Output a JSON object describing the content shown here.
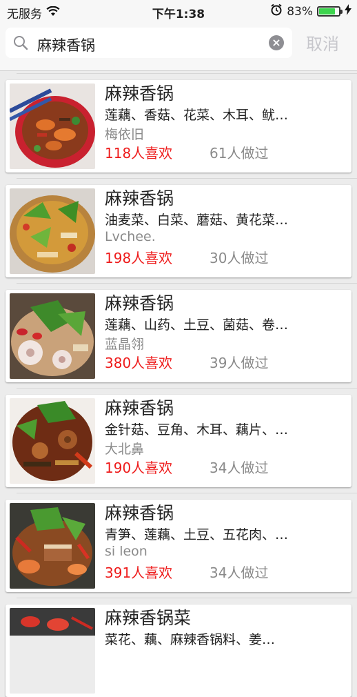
{
  "status_bar": {
    "carrier": "无服务",
    "time": "下午1:38",
    "battery_percent": "83%",
    "battery_level": 0.83
  },
  "search": {
    "query": "麻辣香锅",
    "cancel_label": "取消"
  },
  "results": [
    {
      "title": "麻辣香锅",
      "ingredients": "莲藕、香菇、花菜、木耳、鱿…",
      "author": "梅依旧",
      "likes": "118人喜欢",
      "made": "61人做过",
      "image": "dish-photo-shrimp"
    },
    {
      "title": "麻辣香锅",
      "ingredients": "油麦菜、白菜、蘑菇、黄花菜…",
      "author": "Lvchee.",
      "likes": "198人喜欢",
      "made": "30人做过",
      "image": "dish-photo-vegetables"
    },
    {
      "title": "麻辣香锅",
      "ingredients": "莲藕、山药、土豆、菌菇、卷…",
      "author": "蓝晶翎",
      "likes": "380人喜欢",
      "made": "39人做过",
      "image": "dish-photo-lotus"
    },
    {
      "title": "麻辣香锅",
      "ingredients": "金针菇、豆角、木耳、藕片、…",
      "author": "大北鼻",
      "likes": "190人喜欢",
      "made": "34人做过",
      "image": "dish-photo-mixed"
    },
    {
      "title": "麻辣香锅",
      "ingredients": "青笋、莲藕、土豆、五花肉、…",
      "author": "si  leon",
      "likes": "391人喜欢",
      "made": "34人做过",
      "image": "dish-photo-pork"
    },
    {
      "title": "麻辣香锅菜",
      "ingredients": "菜花、藕、麻辣香锅料、姜…",
      "author": "",
      "likes": "",
      "made": "",
      "image": "dish-photo-partial"
    }
  ],
  "colors": {
    "likes": "#ee1c1c",
    "secondary_text": "#8a8a8a",
    "battery": "#3dd44e"
  }
}
